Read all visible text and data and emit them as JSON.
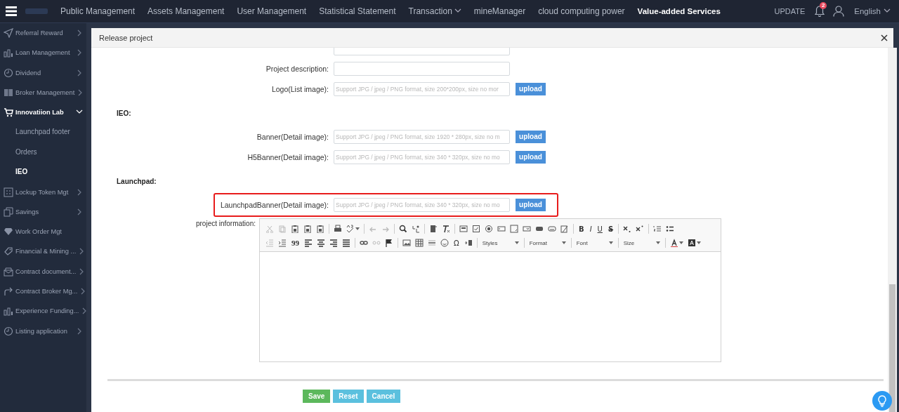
{
  "topbar": {
    "nav": [
      {
        "label": "Public Management",
        "selected": false,
        "dropdown": false
      },
      {
        "label": "Assets Management",
        "selected": false,
        "dropdown": false
      },
      {
        "label": "User Management",
        "selected": false,
        "dropdown": false
      },
      {
        "label": "Statistical Statement",
        "selected": false,
        "dropdown": false
      },
      {
        "label": "Transaction",
        "selected": false,
        "dropdown": true
      },
      {
        "label": "mineManager",
        "selected": false,
        "dropdown": false
      },
      {
        "label": "cloud computing power",
        "selected": false,
        "dropdown": false
      },
      {
        "label": "Value-added Services",
        "selected": true,
        "dropdown": false
      }
    ],
    "update": "UPDATE",
    "notification_count": "2",
    "language": "English"
  },
  "sidebar": {
    "items": [
      {
        "label": "Referral Reward",
        "expandable": true,
        "expanded": false
      },
      {
        "label": "Loan Management",
        "expandable": true,
        "expanded": false
      },
      {
        "label": "Dividend",
        "expandable": true,
        "expanded": false
      },
      {
        "label": "Broker Management",
        "expandable": true,
        "expanded": false
      },
      {
        "label": "Innovatiion Lab",
        "expandable": true,
        "expanded": true,
        "children": [
          {
            "label": "Launchpad footer",
            "selected": false
          },
          {
            "label": "Orders",
            "selected": false
          },
          {
            "label": "IEO",
            "selected": true
          }
        ]
      },
      {
        "label": "Lockup Token Mgt",
        "expandable": true,
        "expanded": false
      },
      {
        "label": "Savings",
        "expandable": true,
        "expanded": false
      },
      {
        "label": "Work Order Mgt",
        "expandable": false,
        "expanded": false
      },
      {
        "label": "Financial & Mining ...",
        "expandable": true,
        "expanded": false
      },
      {
        "label": "Contract document...",
        "expandable": true,
        "expanded": false
      },
      {
        "label": "Contract Broker Mg...",
        "expandable": true,
        "expanded": false
      },
      {
        "label": "Experience Funding...",
        "expandable": true,
        "expanded": false
      },
      {
        "label": "Listing application",
        "expandable": true,
        "expanded": false
      }
    ]
  },
  "dialog": {
    "title": "Release project",
    "form": [
      {
        "kind": "text",
        "highlighted": false
      },
      {
        "kind": "text",
        "label": "Project description:",
        "highlighted": false
      },
      {
        "kind": "upload",
        "label": "Logo(List image):",
        "placeholder": "Support JPG / jpeg / PNG format, size 200*200px, size no mor",
        "button": "upload",
        "highlighted": false
      },
      {
        "kind": "section",
        "label": "IEO:"
      },
      {
        "kind": "upload",
        "label": "Banner(Detail image):",
        "placeholder": "Support JPG / jpeg / PNG format, size 1920 * 280px, size no m",
        "button": "upload",
        "highlighted": false
      },
      {
        "kind": "upload",
        "label": "H5Banner(Detail image):",
        "placeholder": "Support JPG / jpeg / PNG format, size 340 * 320px, size no mo",
        "button": "upload",
        "highlighted": false
      },
      {
        "kind": "section",
        "label": "Launchpad:"
      },
      {
        "kind": "upload",
        "label": "LaunchpadBanner(Detail image):",
        "placeholder": "Support JPG / jpeg / PNG format, size 340 * 320px, size no mo",
        "button": "upload",
        "highlighted": true
      }
    ],
    "editor": {
      "label": "project information:",
      "glyphs": [
        "99",
        "B",
        "I",
        "U",
        "S",
        "Ω"
      ],
      "dropdowns": [
        "Styles",
        "Format",
        "Font",
        "Size"
      ]
    },
    "buttons": [
      {
        "label": "Save",
        "kind": "save"
      },
      {
        "label": "Reset",
        "kind": "reset"
      },
      {
        "label": "Cancel",
        "kind": "cancel"
      }
    ]
  }
}
